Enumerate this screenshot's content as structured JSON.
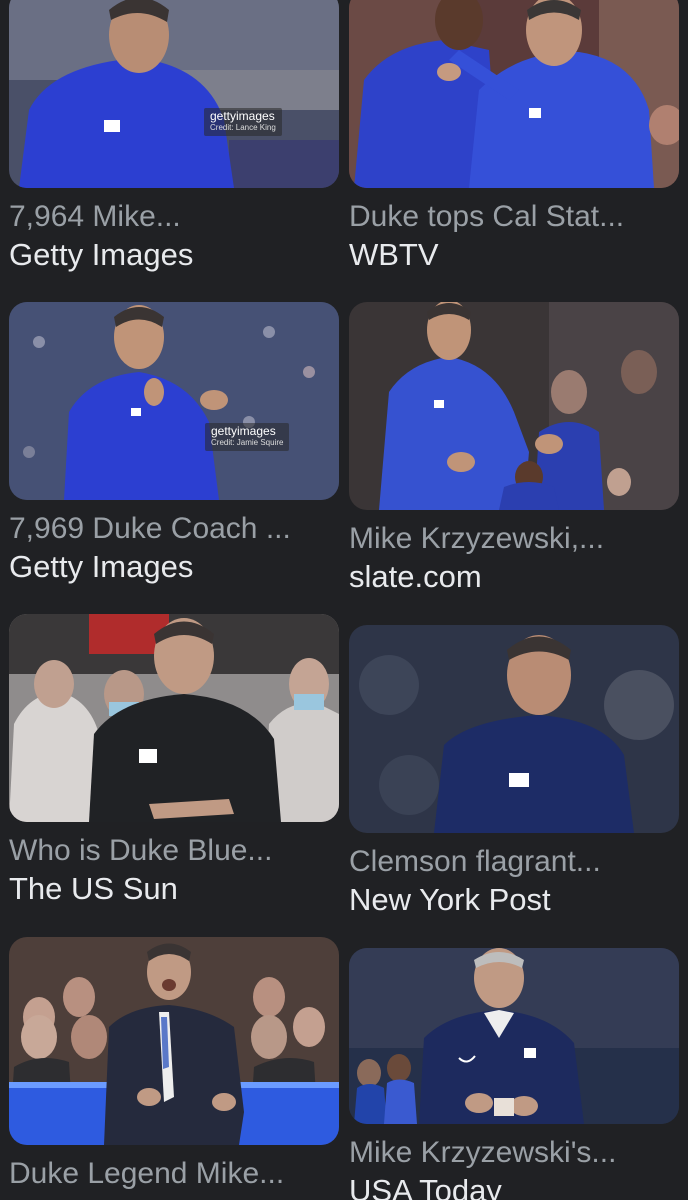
{
  "results": [
    {
      "caption": "7,964 Mike...",
      "source": "Getty Images",
      "watermark": {
        "brand": "gettyimages",
        "credit": "Credit: Lance King"
      }
    },
    {
      "caption": "Duke tops Cal Stat...",
      "source": "WBTV"
    },
    {
      "caption": "7,969 Duke Coach ...",
      "source": "Getty Images",
      "watermark": {
        "brand": "gettyimages",
        "credit": "Credit: Jamie Squire"
      }
    },
    {
      "caption": "Mike Krzyzewski,...",
      "source": "slate.com"
    },
    {
      "caption": "Who is Duke Blue...",
      "source": "The US Sun"
    },
    {
      "caption": "Clemson flagrant...",
      "source": "New York Post"
    },
    {
      "caption": "Duke Legend Mike...",
      "source": ""
    },
    {
      "caption": "Mike Krzyzewski's...",
      "source": "USA Today"
    }
  ],
  "colors": {
    "background": "#202124",
    "caption": "#9aa0a6",
    "source": "#e8eaed",
    "duke_blue": "#2a3fc4",
    "navy": "#1b2a5e"
  },
  "icons": [
    "duke-d-logo",
    "nike-swoosh-icon"
  ]
}
